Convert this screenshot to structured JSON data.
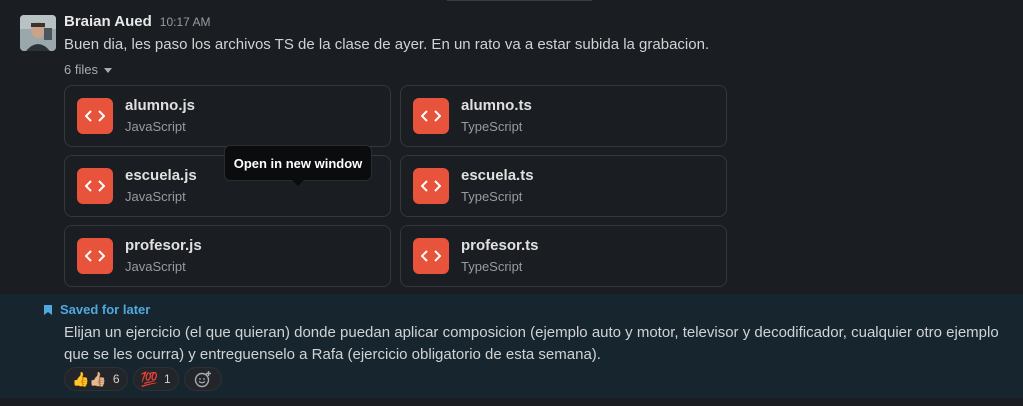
{
  "message": {
    "sender": "Braian Aued",
    "time": "10:17 AM",
    "text": "Buen dia, les paso los archivos TS de la clase de ayer. En un rato va a estar subida la grabacion.",
    "files_label": "6 files",
    "files": [
      {
        "name": "alumno.js",
        "type": "JavaScript",
        "icon": "code-icon"
      },
      {
        "name": "alumno.ts",
        "type": "TypeScript",
        "icon": "code-icon"
      },
      {
        "name": "escuela.js",
        "type": "JavaScript",
        "icon": "code-icon"
      },
      {
        "name": "escuela.ts",
        "type": "TypeScript",
        "icon": "code-icon"
      },
      {
        "name": "profesor.js",
        "type": "JavaScript",
        "icon": "code-icon"
      },
      {
        "name": "profesor.ts",
        "type": "TypeScript",
        "icon": "code-icon"
      }
    ],
    "tooltip": "Open in new window"
  },
  "saved": {
    "label": "Saved for later",
    "text": "Elijan un ejercicio (el que quieran) donde puedan aplicar composicion (ejemplo auto y motor, televisor y decodificador, cualquier otro ejemplo que se les ocurra)  y entreguenselo a Rafa (ejercicio obligatorio de esta semana).",
    "reactions": [
      {
        "emoji": "👍👍🏼",
        "count": "6"
      },
      {
        "emoji": "💯",
        "count": "1"
      }
    ]
  },
  "colors": {
    "background": "#1a1d21",
    "saved_background": "#17262e",
    "file_icon": "#e8533c",
    "saved_accent": "#4fa8e0"
  }
}
